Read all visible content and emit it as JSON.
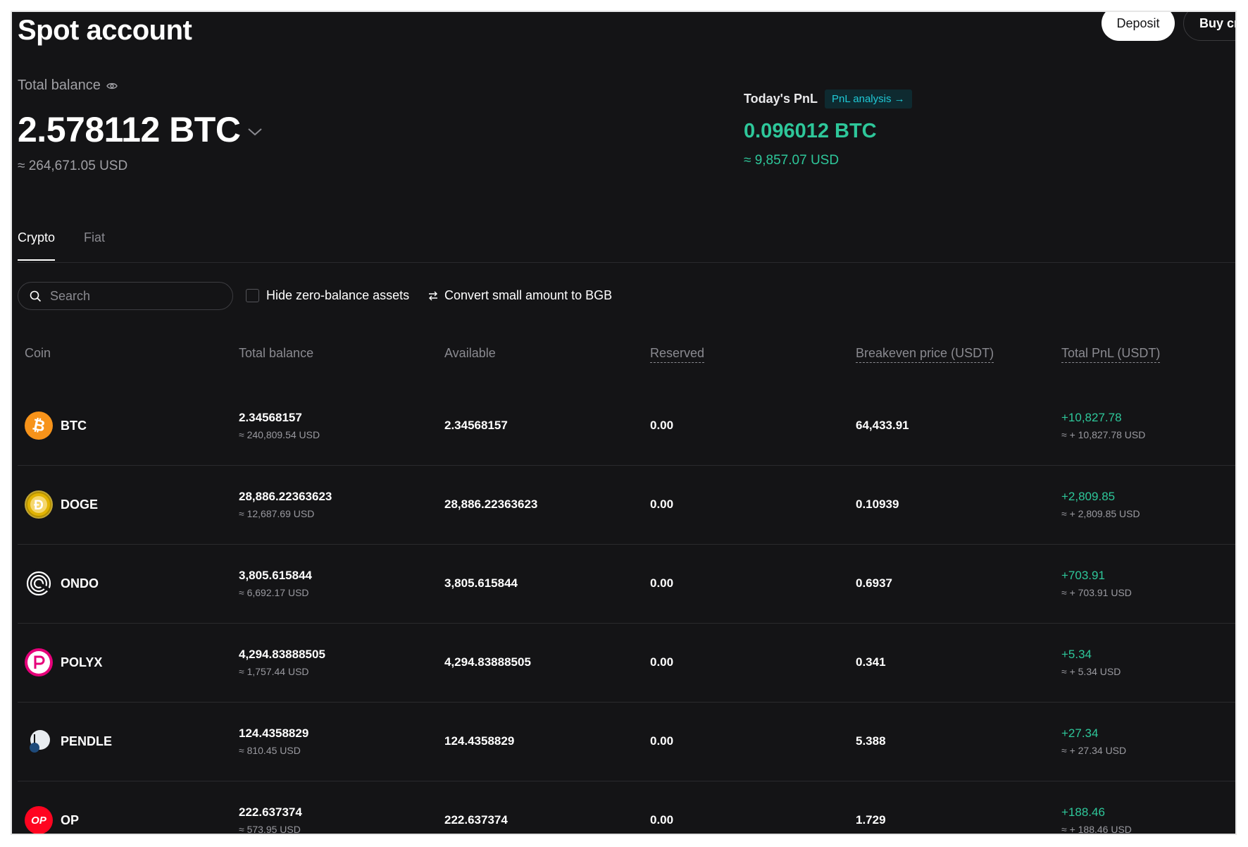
{
  "page": {
    "title": "Spot account"
  },
  "actions": {
    "deposit_label": "Deposit",
    "buy_label": "Buy crypto"
  },
  "balance": {
    "label": "Total balance",
    "value": "2.578112 BTC",
    "usd": "≈ 264,671.05 USD"
  },
  "pnl": {
    "label": "Today's PnL",
    "analysis_link": "PnL analysis",
    "value": "0.096012 BTC",
    "usd": "≈ 9,857.07 USD"
  },
  "tabs": [
    {
      "label": "Crypto",
      "active": true
    },
    {
      "label": "Fiat",
      "active": false
    }
  ],
  "toolbar": {
    "search_placeholder": "Search",
    "hide_zero_label": "Hide zero-balance assets",
    "convert_label": "Convert small amount to BGB"
  },
  "table": {
    "columns": [
      "Coin",
      "Total balance",
      "Available",
      "Reserved",
      "Breakeven price (USDT)",
      "Total PnL (USDT)"
    ],
    "rows": [
      {
        "coin": "BTC",
        "logo": "btc-logo-icon",
        "total": "2.34568157",
        "total_usd": "≈ 240,809.54 USD",
        "available": "2.34568157",
        "reserved": "0.00",
        "breakeven": "64,433.91",
        "pnl": "+10,827.78",
        "pnl_usd": "≈ + 10,827.78 USD"
      },
      {
        "coin": "DOGE",
        "logo": "doge-logo-icon",
        "total": "28,886.22363623",
        "total_usd": "≈ 12,687.69 USD",
        "available": "28,886.22363623",
        "reserved": "0.00",
        "breakeven": "0.10939",
        "pnl": "+2,809.85",
        "pnl_usd": "≈ + 2,809.85 USD"
      },
      {
        "coin": "ONDO",
        "logo": "ondo-logo-icon",
        "total": "3,805.615844",
        "total_usd": "≈ 6,692.17 USD",
        "available": "3,805.615844",
        "reserved": "0.00",
        "breakeven": "0.6937",
        "pnl": "+703.91",
        "pnl_usd": "≈ + 703.91 USD"
      },
      {
        "coin": "POLYX",
        "logo": "polyx-logo-icon",
        "total": "4,294.83888505",
        "total_usd": "≈ 1,757.44 USD",
        "available": "4,294.83888505",
        "reserved": "0.00",
        "breakeven": "0.341",
        "pnl": "+5.34",
        "pnl_usd": "≈ + 5.34 USD"
      },
      {
        "coin": "PENDLE",
        "logo": "pendle-logo-icon",
        "total": "124.4358829",
        "total_usd": "≈ 810.45 USD",
        "available": "124.4358829",
        "reserved": "0.00",
        "breakeven": "5.388",
        "pnl": "+27.34",
        "pnl_usd": "≈ + 27.34 USD"
      },
      {
        "coin": "OP",
        "logo": "op-logo-icon",
        "total": "222.637374",
        "total_usd": "≈ 573.95 USD",
        "available": "222.637374",
        "reserved": "0.00",
        "breakeven": "1.729",
        "pnl": "+188.46",
        "pnl_usd": "≈ + 188.46 USD"
      }
    ]
  },
  "colors": {
    "background": "#141416",
    "accent_green": "#2ec79a",
    "link_cyan": "#20c9d6",
    "btc_orange": "#f7931a",
    "op_red": "#ff0420",
    "polyx_pink": "#e6007a"
  },
  "logo_text": {
    "op": "OP"
  }
}
